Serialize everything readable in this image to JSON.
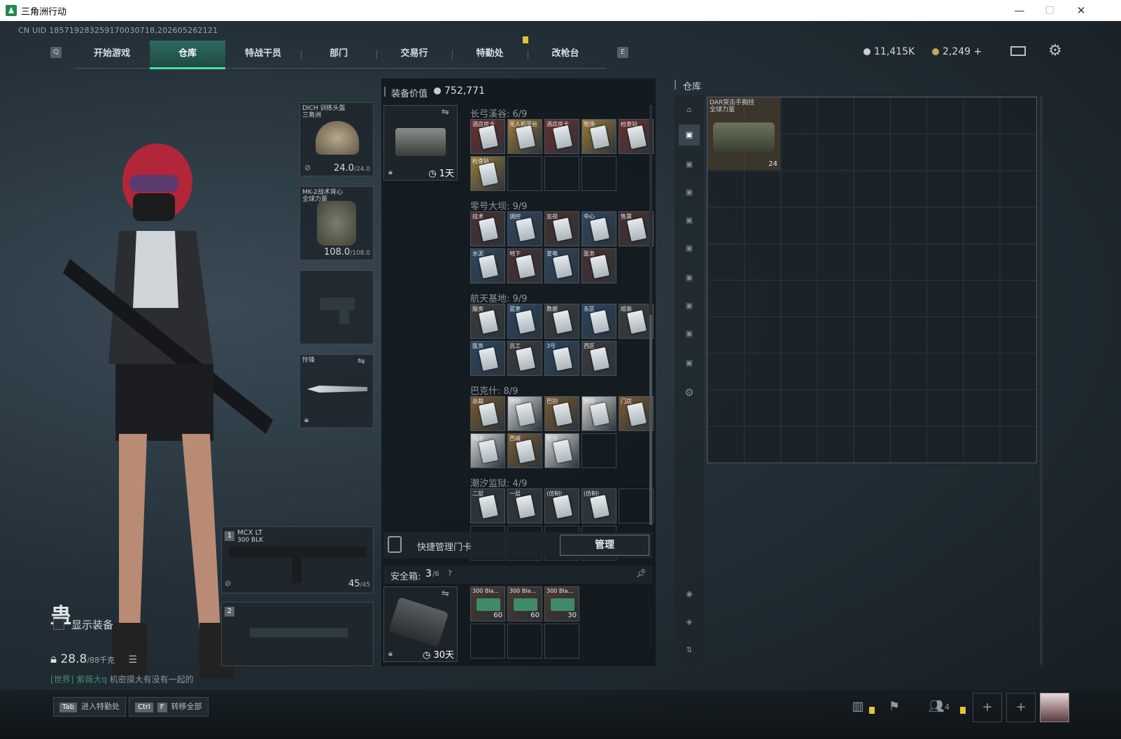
{
  "window": {
    "title": "三角洲行动"
  },
  "uid": "CN UID 185719283259170030718,202605262121",
  "nav": {
    "left_key": "Q",
    "right_key": "E",
    "tabs": [
      "开始游戏",
      "仓库",
      "特战干员",
      "部门",
      "交易行",
      "特勤处",
      "改枪台"
    ],
    "active": "仓库"
  },
  "currency": {
    "silver": "11,415K",
    "gold": "2,249 +"
  },
  "player": {
    "name": "蛊",
    "show_equipment": "显示装备",
    "weight": "28.8",
    "weight_max": "/88千克"
  },
  "chat": {
    "channel": "[世界]",
    "user": "紫薇大q",
    "text": "机密摸大有没有一起的"
  },
  "equipment": {
    "helmet": {
      "name": "DICH 训练头盔",
      "sub": "三角洲",
      "durability": "24.0",
      "durability_max": "/24.0"
    },
    "armor": {
      "name": "MK-2战术背心",
      "sub": "全球力量",
      "durability": "108.0",
      "durability_max": "/108.0"
    },
    "melee": {
      "name": "怜锋"
    },
    "weapon1": {
      "slot": "1",
      "name": "MCX LT",
      "caliber": "300 BLK",
      "ammo": "45",
      "ammo_max": "/45"
    },
    "weapon2": {
      "slot": "2"
    }
  },
  "keycards": {
    "equipment_value_label": "装备价值",
    "equipment_value": "752,771",
    "holder_duration": "1天",
    "groups": [
      {
        "name": "长弓溪谷",
        "count": "6/9",
        "cards": [
          "酒店房卡",
          "无人机平台",
          "酒店房卡",
          "牧场",
          "检查站",
          "检查站"
        ]
      },
      {
        "name": "零号大坝",
        "count": "9/9",
        "cards": [
          "技术",
          "调控",
          "监视",
          "中心",
          "售票",
          "水泥",
          "地下",
          "变电",
          "医务"
        ]
      },
      {
        "name": "航天基地",
        "count": "9/9",
        "cards": [
          "服务",
          "蓝室",
          "数据",
          "东区",
          "组装",
          "医务",
          "员工",
          "3号",
          "西区"
        ]
      },
      {
        "name": "巴克什",
        "count": "8/9",
        "cards": [
          "总裁",
          "博物",
          "巴别",
          "博物",
          "门店",
          "海港",
          "西城",
          "老浴"
        ]
      },
      {
        "name": "潮汐监狱",
        "count": "4/9",
        "cards": [
          "二层",
          "一层",
          "(仿制)",
          "(仿制)"
        ]
      }
    ],
    "quick_manage_label": "快捷管理门卡",
    "manage_button": "管理"
  },
  "safebox": {
    "label": "安全箱:",
    "count": "3",
    "count_max": "/6",
    "help": "?",
    "duration": "30天",
    "items": [
      {
        "name": "300 Bla...",
        "qty": "60"
      },
      {
        "name": "300 Bla...",
        "qty": "60"
      },
      {
        "name": "300 Bla...",
        "qty": "30"
      }
    ]
  },
  "storage": {
    "title": "仓库",
    "item": {
      "name": "DAR突击手胸挂",
      "sub": "全球力量",
      "qty": "24"
    }
  },
  "bottom": {
    "tab_key": "Tab",
    "tab_label": "进入特勤处",
    "ctrl_key": "Ctrl",
    "f_key": "F",
    "transfer_label": "转移全部",
    "friends": "4"
  },
  "colors": {
    "accent": "#4bdc9c",
    "gold_card": "#b88a3a",
    "red_card": "#7a2a2a",
    "blue_card": "#2a4a6a"
  }
}
